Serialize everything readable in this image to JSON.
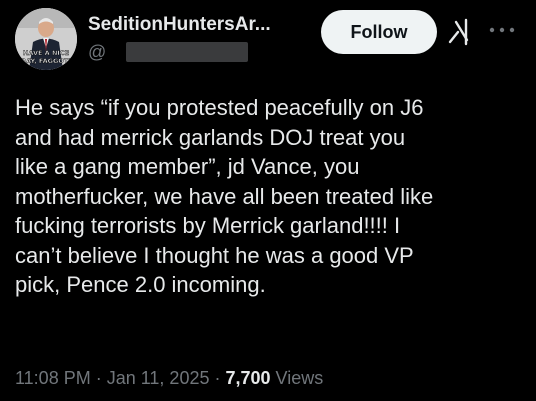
{
  "author": {
    "display_name": "SeditionHuntersAr...",
    "handle_prefix": "@",
    "avatar_caption_line1": "HAVE A NICE",
    "avatar_caption_line2": "DAY, FAGGOT!"
  },
  "actions": {
    "follow_label": "Follow",
    "grok_icon": "grok-icon",
    "more_icon": "more-icon"
  },
  "tweet": {
    "text": "He says “if you protested peacefully on J6\nand had merrick garlands DOJ  treat you\nlike a gang member”, jd Vance, you\nmotherfucker, we have all been treated like\nfucking terrorists by Merrick garland!!!!  I\ncan’t believe I thought he was a good VP\npick, Pence 2.0 incoming."
  },
  "meta": {
    "time": "11:08 PM",
    "separator": " · ",
    "date": "Jan 11, 2025",
    "views_count": "7,700",
    "views_label": " Views"
  },
  "colors": {
    "background": "#000000",
    "text": "#e7e9ea",
    "secondary": "#71767b",
    "button_bg": "#eff3f4"
  }
}
